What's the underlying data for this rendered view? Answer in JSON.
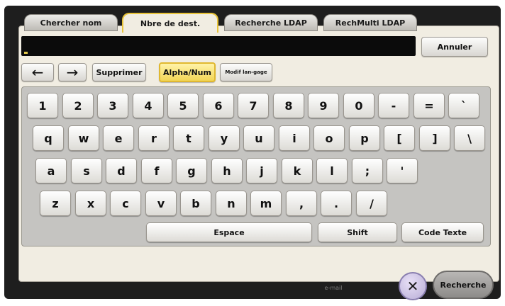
{
  "tabs": [
    "Chercher nom",
    "Nbre de dest.",
    "Recherche LDAP",
    "RechMulti LDAP"
  ],
  "cancel_label": "Annuler",
  "toolbar": {
    "back": "←",
    "forward": "→",
    "delete": "Supprimer",
    "alphanum": "Alpha/Num",
    "lang": "Modif lan-gage"
  },
  "keyboard": {
    "row1": [
      "1",
      "2",
      "3",
      "4",
      "5",
      "6",
      "7",
      "8",
      "9",
      "0",
      "-",
      "=",
      "`"
    ],
    "row2": [
      "q",
      "w",
      "e",
      "r",
      "t",
      "y",
      "u",
      "i",
      "o",
      "p",
      "[",
      "]",
      "\\"
    ],
    "row3": [
      "a",
      "s",
      "d",
      "f",
      "g",
      "h",
      "j",
      "k",
      "l",
      ";",
      "'"
    ],
    "row4": [
      "z",
      "x",
      "c",
      "v",
      "b",
      "n",
      "m",
      ",",
      ".",
      "/"
    ],
    "space": "Espace",
    "shift": "Shift",
    "code": "Code Texte"
  },
  "bottom": {
    "close_icon": "✕",
    "search": "Recherche",
    "ghost_text": "e-mail"
  }
}
